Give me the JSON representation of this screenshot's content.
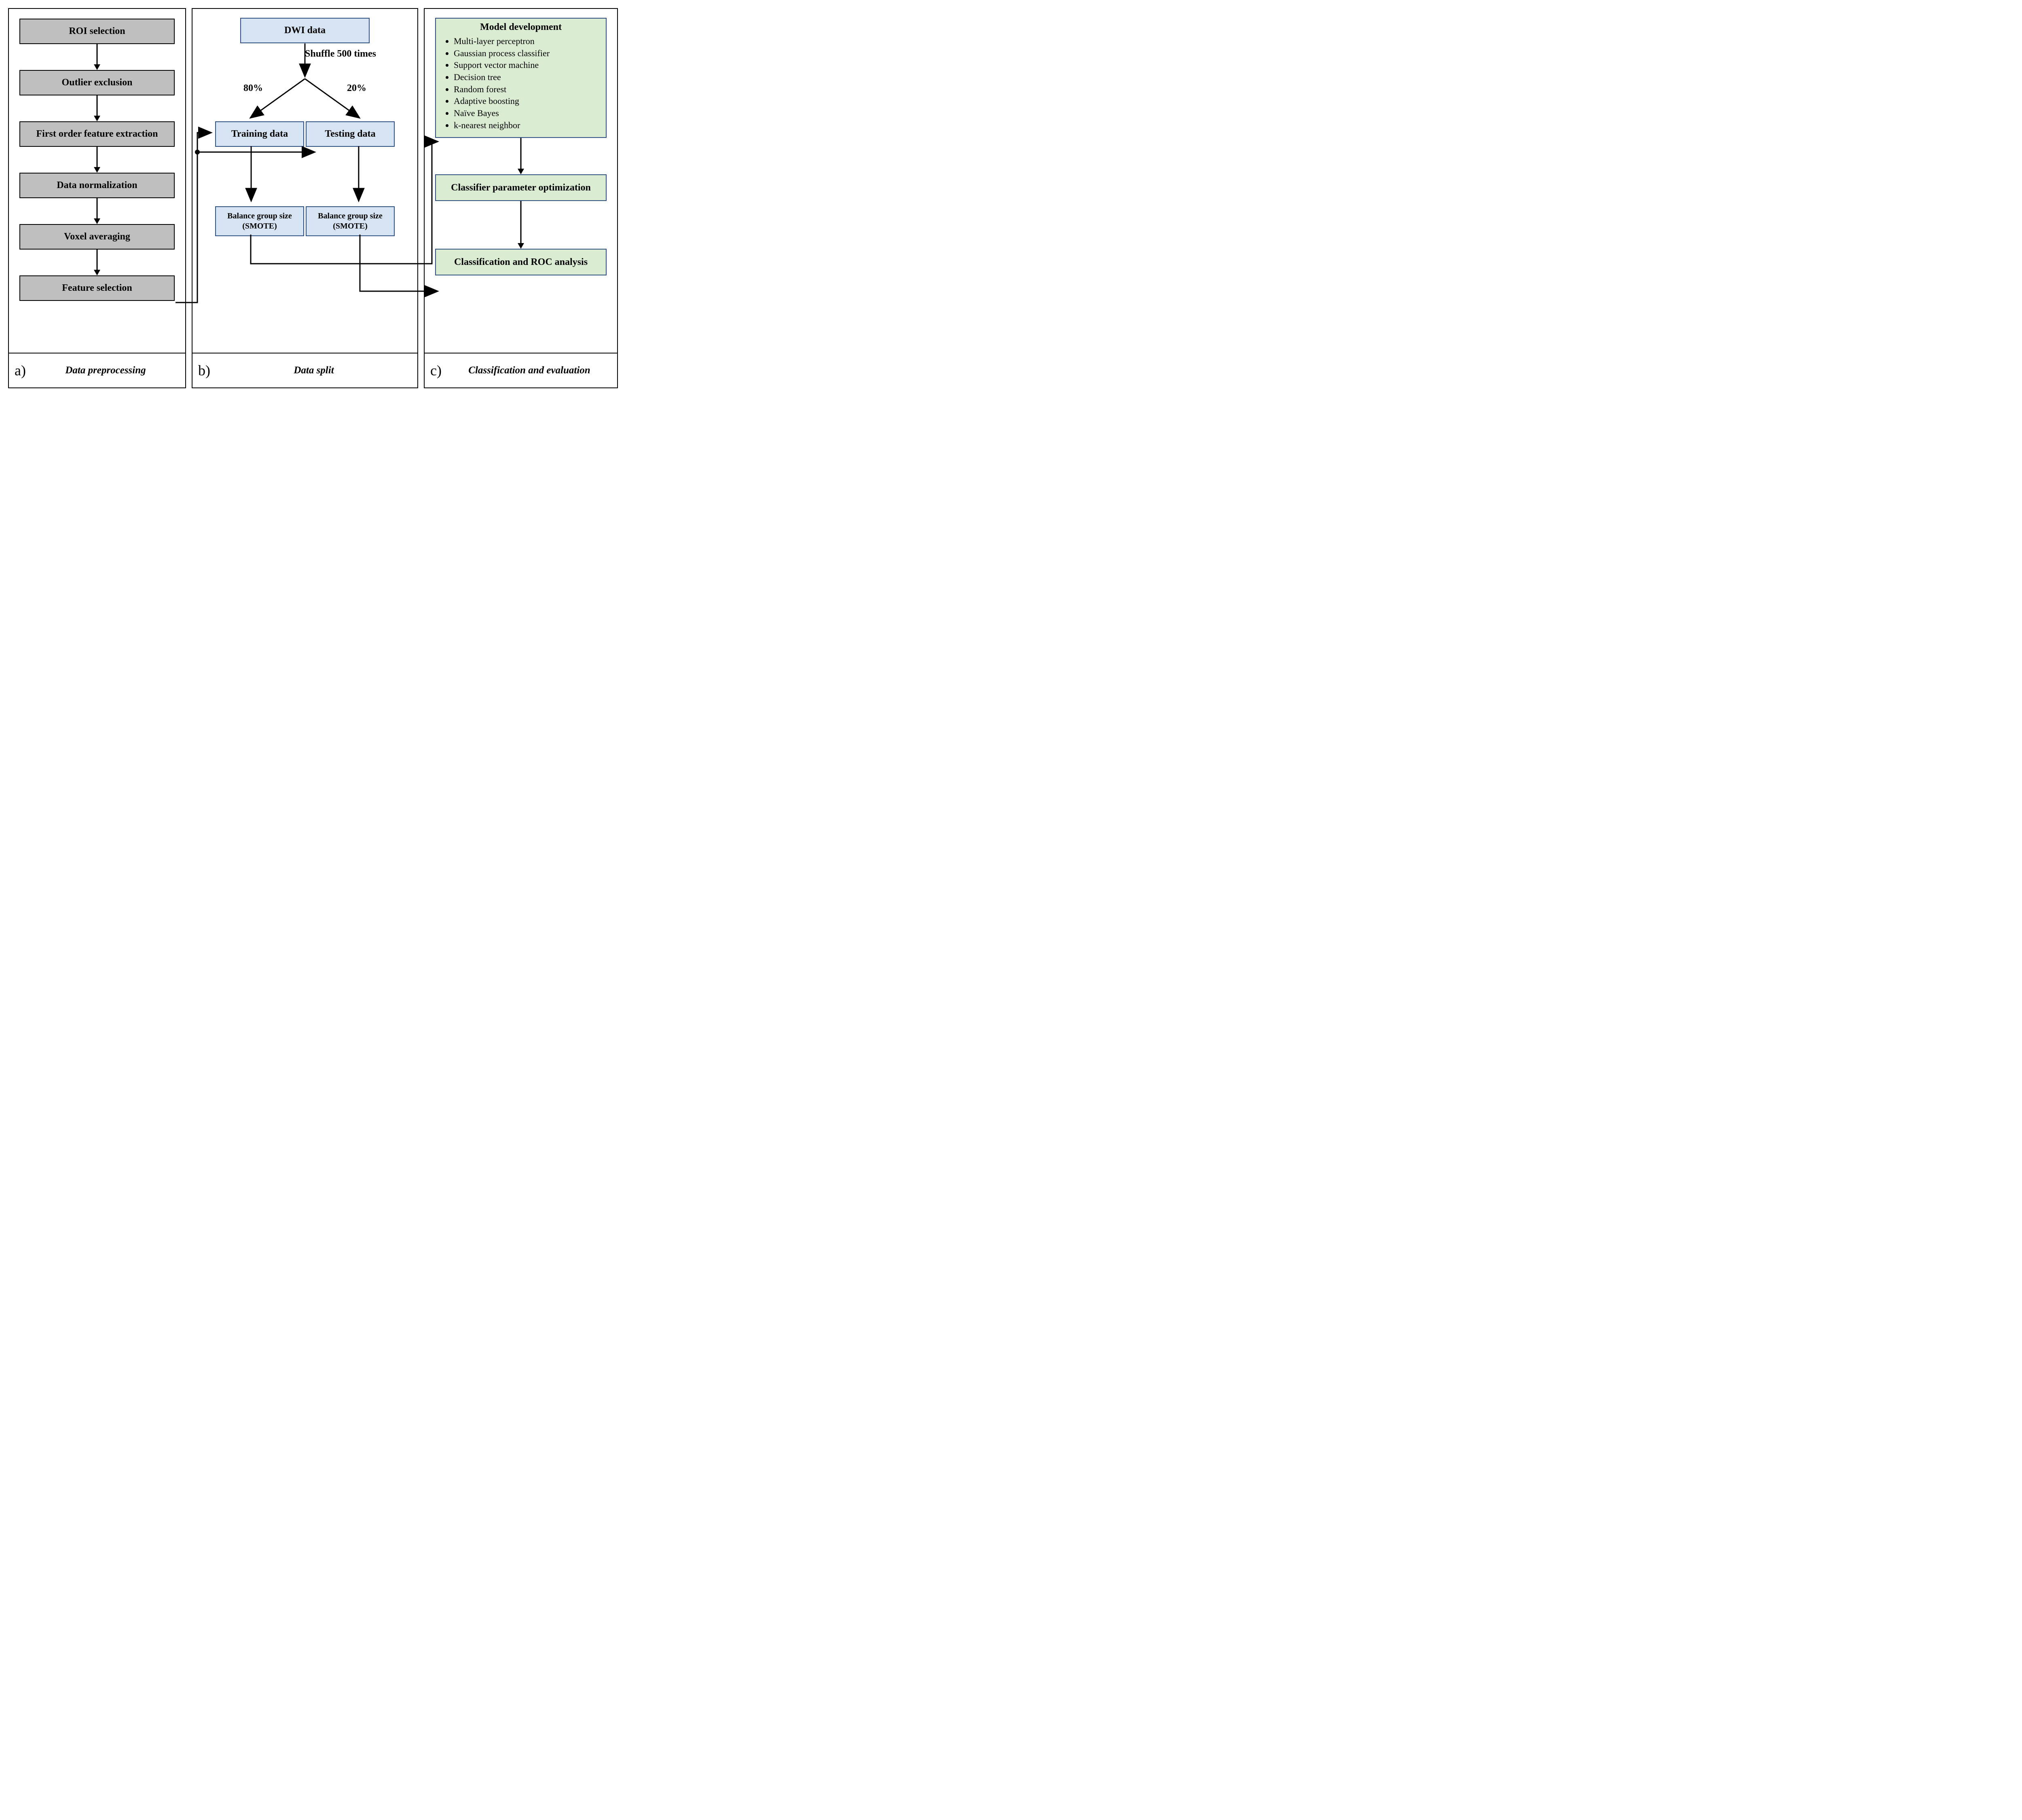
{
  "panelA": {
    "letter": "a)",
    "footer": "Data preprocessing",
    "steps": [
      "ROI selection",
      "Outlier exclusion",
      "First order feature extraction",
      "Data normalization",
      "Voxel averaging",
      "Feature selection"
    ]
  },
  "panelB": {
    "letter": "b)",
    "footer": "Data split",
    "dwi": "DWI data",
    "shuffle": "Shuffle 500 times",
    "pct80": "80%",
    "pct20": "20%",
    "train": "Training data",
    "test": "Testing data",
    "smote": "Balance group size (SMOTE)"
  },
  "panelC": {
    "letter": "c)",
    "footer": "Classification and evaluation",
    "model_title": "Model development",
    "models": [
      "Multi-layer perceptron",
      "Gaussian process classifier",
      "Support vector machine",
      "Decision tree",
      "Random forest",
      "Adaptive boosting",
      "Naïve Bayes",
      "k-nearest neighbor"
    ],
    "optimize": "Classifier parameter optimization",
    "roc": "Classification and ROC analysis"
  }
}
